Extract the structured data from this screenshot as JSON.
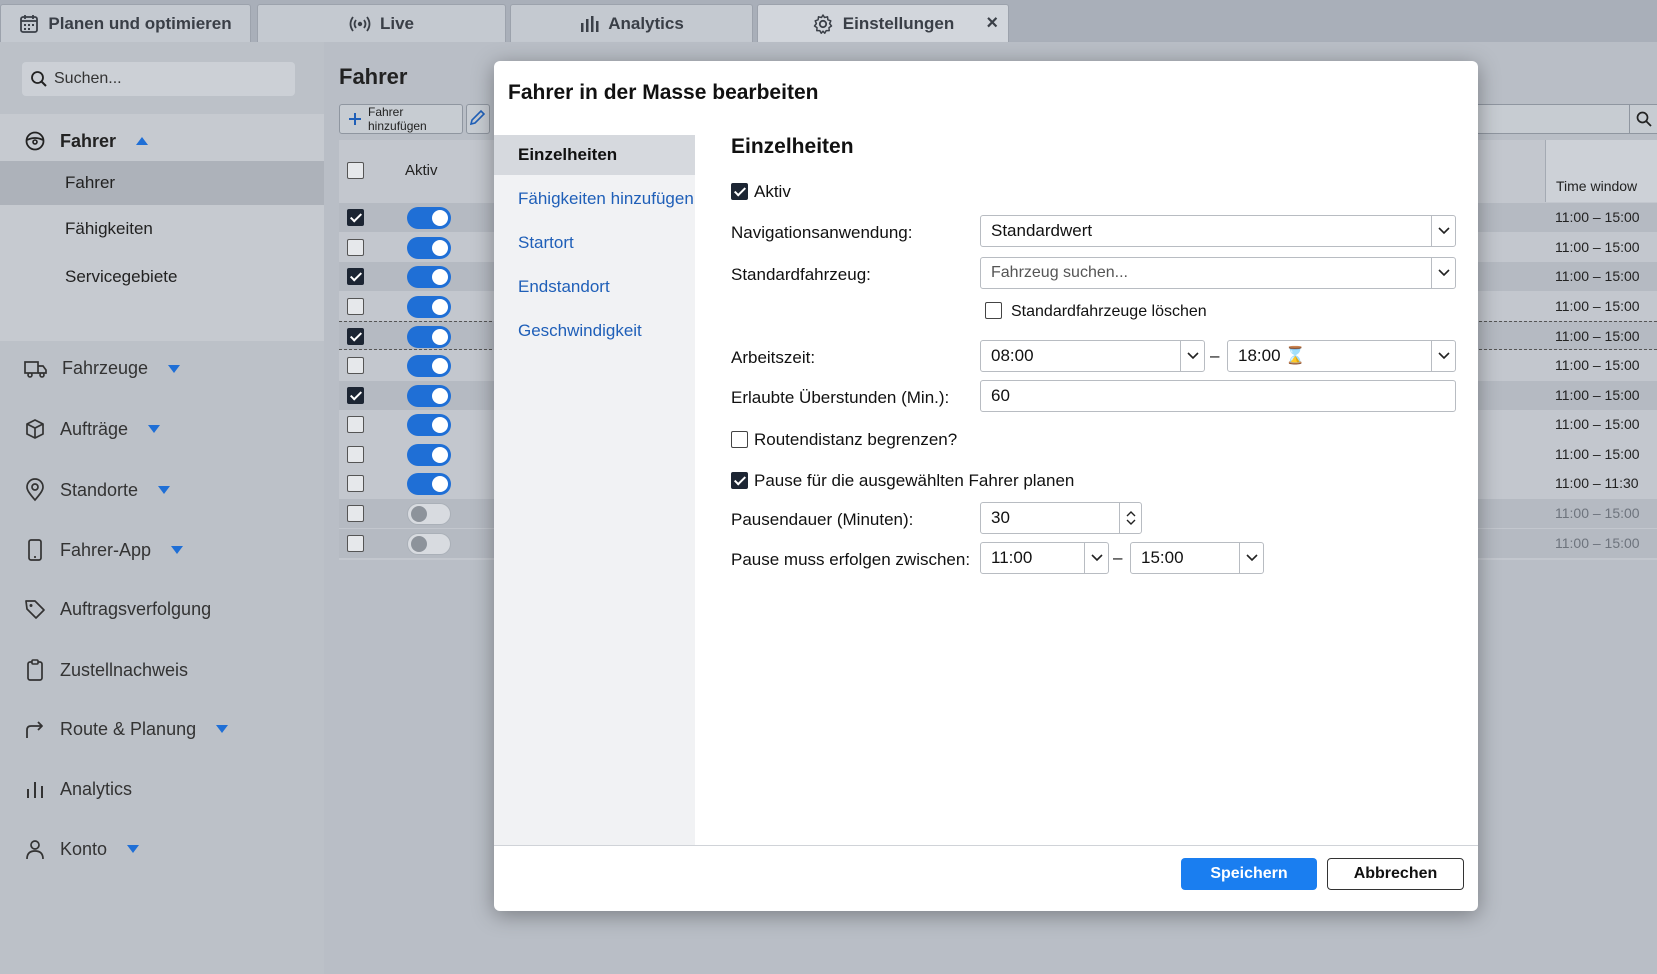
{
  "tabs": [
    {
      "label": "Planen und optimieren",
      "icon": "calendar-icon"
    },
    {
      "label": "Live",
      "icon": "broadcast-icon"
    },
    {
      "label": "Analytics",
      "icon": "bar-chart-icon"
    },
    {
      "label": "Einstellungen",
      "icon": "gear-icon",
      "active": true,
      "close": "×"
    }
  ],
  "sidebar": {
    "search_placeholder": "Suchen...",
    "group_title": "Fahrer",
    "sub_items": [
      "Fahrer",
      "Fähigkeiten",
      "Servicegebiete"
    ],
    "items": [
      {
        "label": "Fahrzeuge",
        "icon": "truck-icon",
        "caret": true
      },
      {
        "label": "Aufträge",
        "icon": "package-icon",
        "caret": true
      },
      {
        "label": "Standorte",
        "icon": "map-pin-icon",
        "caret": true
      },
      {
        "label": "Fahrer-App",
        "icon": "phone-icon",
        "caret": true
      },
      {
        "label": "Auftragsverfolgung",
        "icon": "tag-icon",
        "caret": false
      },
      {
        "label": "Zustellnachweis",
        "icon": "clipboard-icon",
        "caret": false
      },
      {
        "label": "Route & Planung",
        "icon": "route-arrow-icon",
        "caret": true
      },
      {
        "label": "Analytics",
        "icon": "bar-chart-icon",
        "caret": false
      },
      {
        "label": "Konto",
        "icon": "user-icon",
        "caret": true
      }
    ]
  },
  "main": {
    "title": "Fahrer",
    "add_button": "Fahrer hinzufügen",
    "col_aktiv": "Aktiv",
    "col_time_window": "Time window",
    "rows": [
      {
        "checked": true,
        "active": true,
        "time_window": "11:00 – 15:00",
        "shade": true
      },
      {
        "checked": false,
        "active": true,
        "time_window": "11:00 – 15:00",
        "shade": false
      },
      {
        "checked": true,
        "active": true,
        "time_window": "11:00 – 15:00",
        "shade": true
      },
      {
        "checked": false,
        "active": true,
        "time_window": "11:00 – 15:00",
        "shade": false
      },
      {
        "checked": true,
        "active": true,
        "time_window": "11:00 – 15:00",
        "shade": true,
        "dashed": true
      },
      {
        "checked": false,
        "active": true,
        "time_window": "11:00 – 15:00",
        "shade": false
      },
      {
        "checked": true,
        "active": true,
        "time_window": "11:00 – 15:00",
        "shade": true
      },
      {
        "checked": false,
        "active": true,
        "time_window": "11:00 – 15:00",
        "shade": false
      },
      {
        "checked": false,
        "active": true,
        "time_window": "11:00 – 15:00",
        "shade": false
      },
      {
        "checked": false,
        "active": true,
        "time_window": "11:00 – 11:30",
        "shade": false
      },
      {
        "checked": false,
        "active": false,
        "time_window": "11:00 – 15:00",
        "shade": true
      },
      {
        "checked": false,
        "active": false,
        "time_window": "11:00 – 15:00",
        "shade": true
      }
    ]
  },
  "modal": {
    "title": "Fahrer in der Masse bearbeiten",
    "nav": [
      "Einzelheiten",
      "Fähigkeiten hinzufügen",
      "Startort",
      "Endstandort",
      "Geschwindigkeit"
    ],
    "section_title": "Einzelheiten",
    "aktiv_label": "Aktiv",
    "nav_app_label": "Navigationsanwendung:",
    "nav_app_value": "Standardwert",
    "vehicle_label": "Standardfahrzeug:",
    "vehicle_placeholder": "Fahrzeug suchen...",
    "clear_vehicles_label": "Standardfahrzeuge löschen",
    "worktime_label": "Arbeitszeit:",
    "worktime_start": "08:00",
    "worktime_end": "18:00",
    "worktime_end_icon": "⌛",
    "overtime_label": "Erlaubte Überstunden (Min.):",
    "overtime_value": "60",
    "route_limit_label": "Routendistanz begrenzen?",
    "pause_label": "Pause für die ausgewählten Fahrer planen",
    "pause_duration_label": "Pausendauer (Minuten):",
    "pause_duration_value": "30",
    "pause_between_label": "Pause muss erfolgen zwischen:",
    "pause_start": "11:00",
    "pause_end": "15:00",
    "dash": "–",
    "save": "Speichern",
    "cancel": "Abbrechen"
  },
  "colors": {
    "accent": "#1a7ef0",
    "toggle_on": "#1f6fd6"
  }
}
